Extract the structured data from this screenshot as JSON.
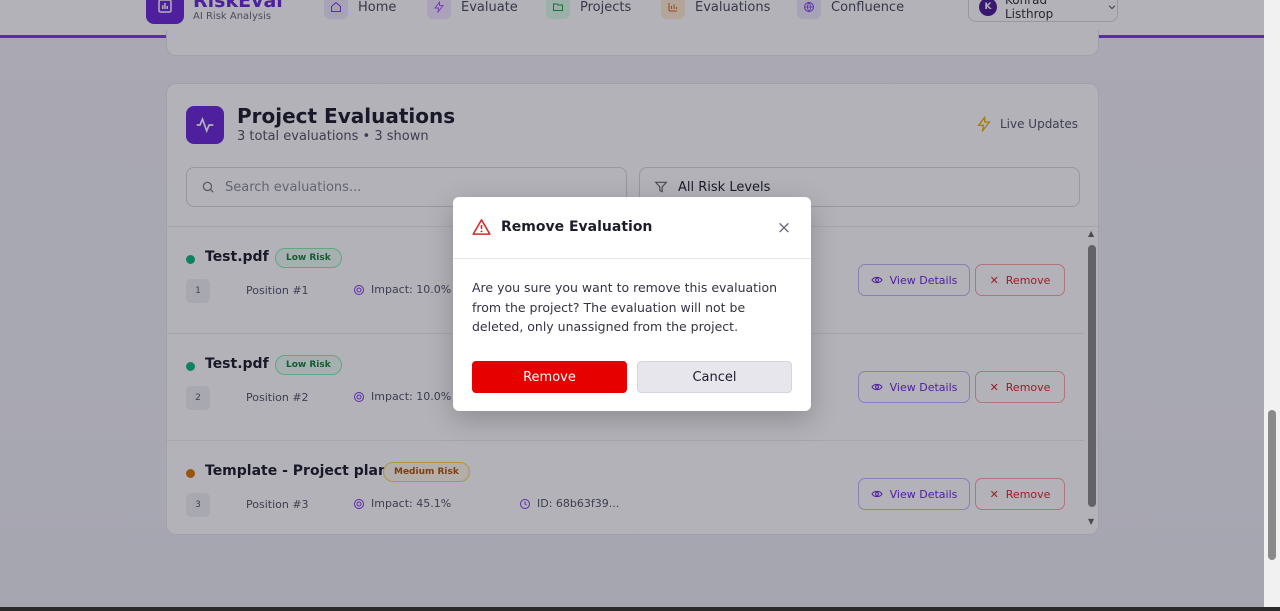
{
  "header": {
    "brand_name": "RiskEval",
    "brand_sub": "AI Risk Analysis",
    "nav": [
      {
        "label": "Home",
        "icon": "home-icon",
        "color": "#ede9fe"
      },
      {
        "label": "Evaluate",
        "icon": "lightning-icon",
        "color": "#f3e8ff"
      },
      {
        "label": "Projects",
        "icon": "folder-icon",
        "color": "#dcfce7"
      },
      {
        "label": "Evaluations",
        "icon": "bar-chart-icon",
        "color": "#ffedd5"
      },
      {
        "label": "Confluence",
        "icon": "globe-icon",
        "color": "#ede9fe"
      }
    ],
    "user": {
      "initial": "K",
      "name": "Konrad Listhrop"
    }
  },
  "card": {
    "title": "Project Evaluations",
    "subtitle": "3 total evaluations • 3 shown",
    "live_updates": "Live Updates",
    "search_placeholder": "Search evaluations...",
    "risk_filter": "All Risk Levels",
    "view_label": "View Details",
    "remove_label": "Remove",
    "rows": [
      {
        "title": "Test.pdf",
        "badge": "Low Risk",
        "num": "1",
        "position": "Position #1",
        "impact": "Impact: 10.0%",
        "id": ""
      },
      {
        "title": "Test.pdf",
        "badge": "Low Risk",
        "num": "2",
        "position": "Position #2",
        "impact": "Impact: 10.0%",
        "id": ""
      },
      {
        "title": "Template - Project plan",
        "badge": "Medium Risk",
        "num": "3",
        "position": "Position #3",
        "impact": "Impact: 45.1%",
        "id": "ID: 68b63f39..."
      }
    ]
  },
  "modal": {
    "title": "Remove Evaluation",
    "body": "Are you sure you want to remove this evaluation from the project? The evaluation will not be deleted, only unassigned from the project.",
    "confirm_label": "Remove",
    "cancel_label": "Cancel"
  },
  "colors": {
    "brand": "#6d28d9",
    "danger": "#e60000",
    "low": "#10b981",
    "medium": "#d97706"
  }
}
